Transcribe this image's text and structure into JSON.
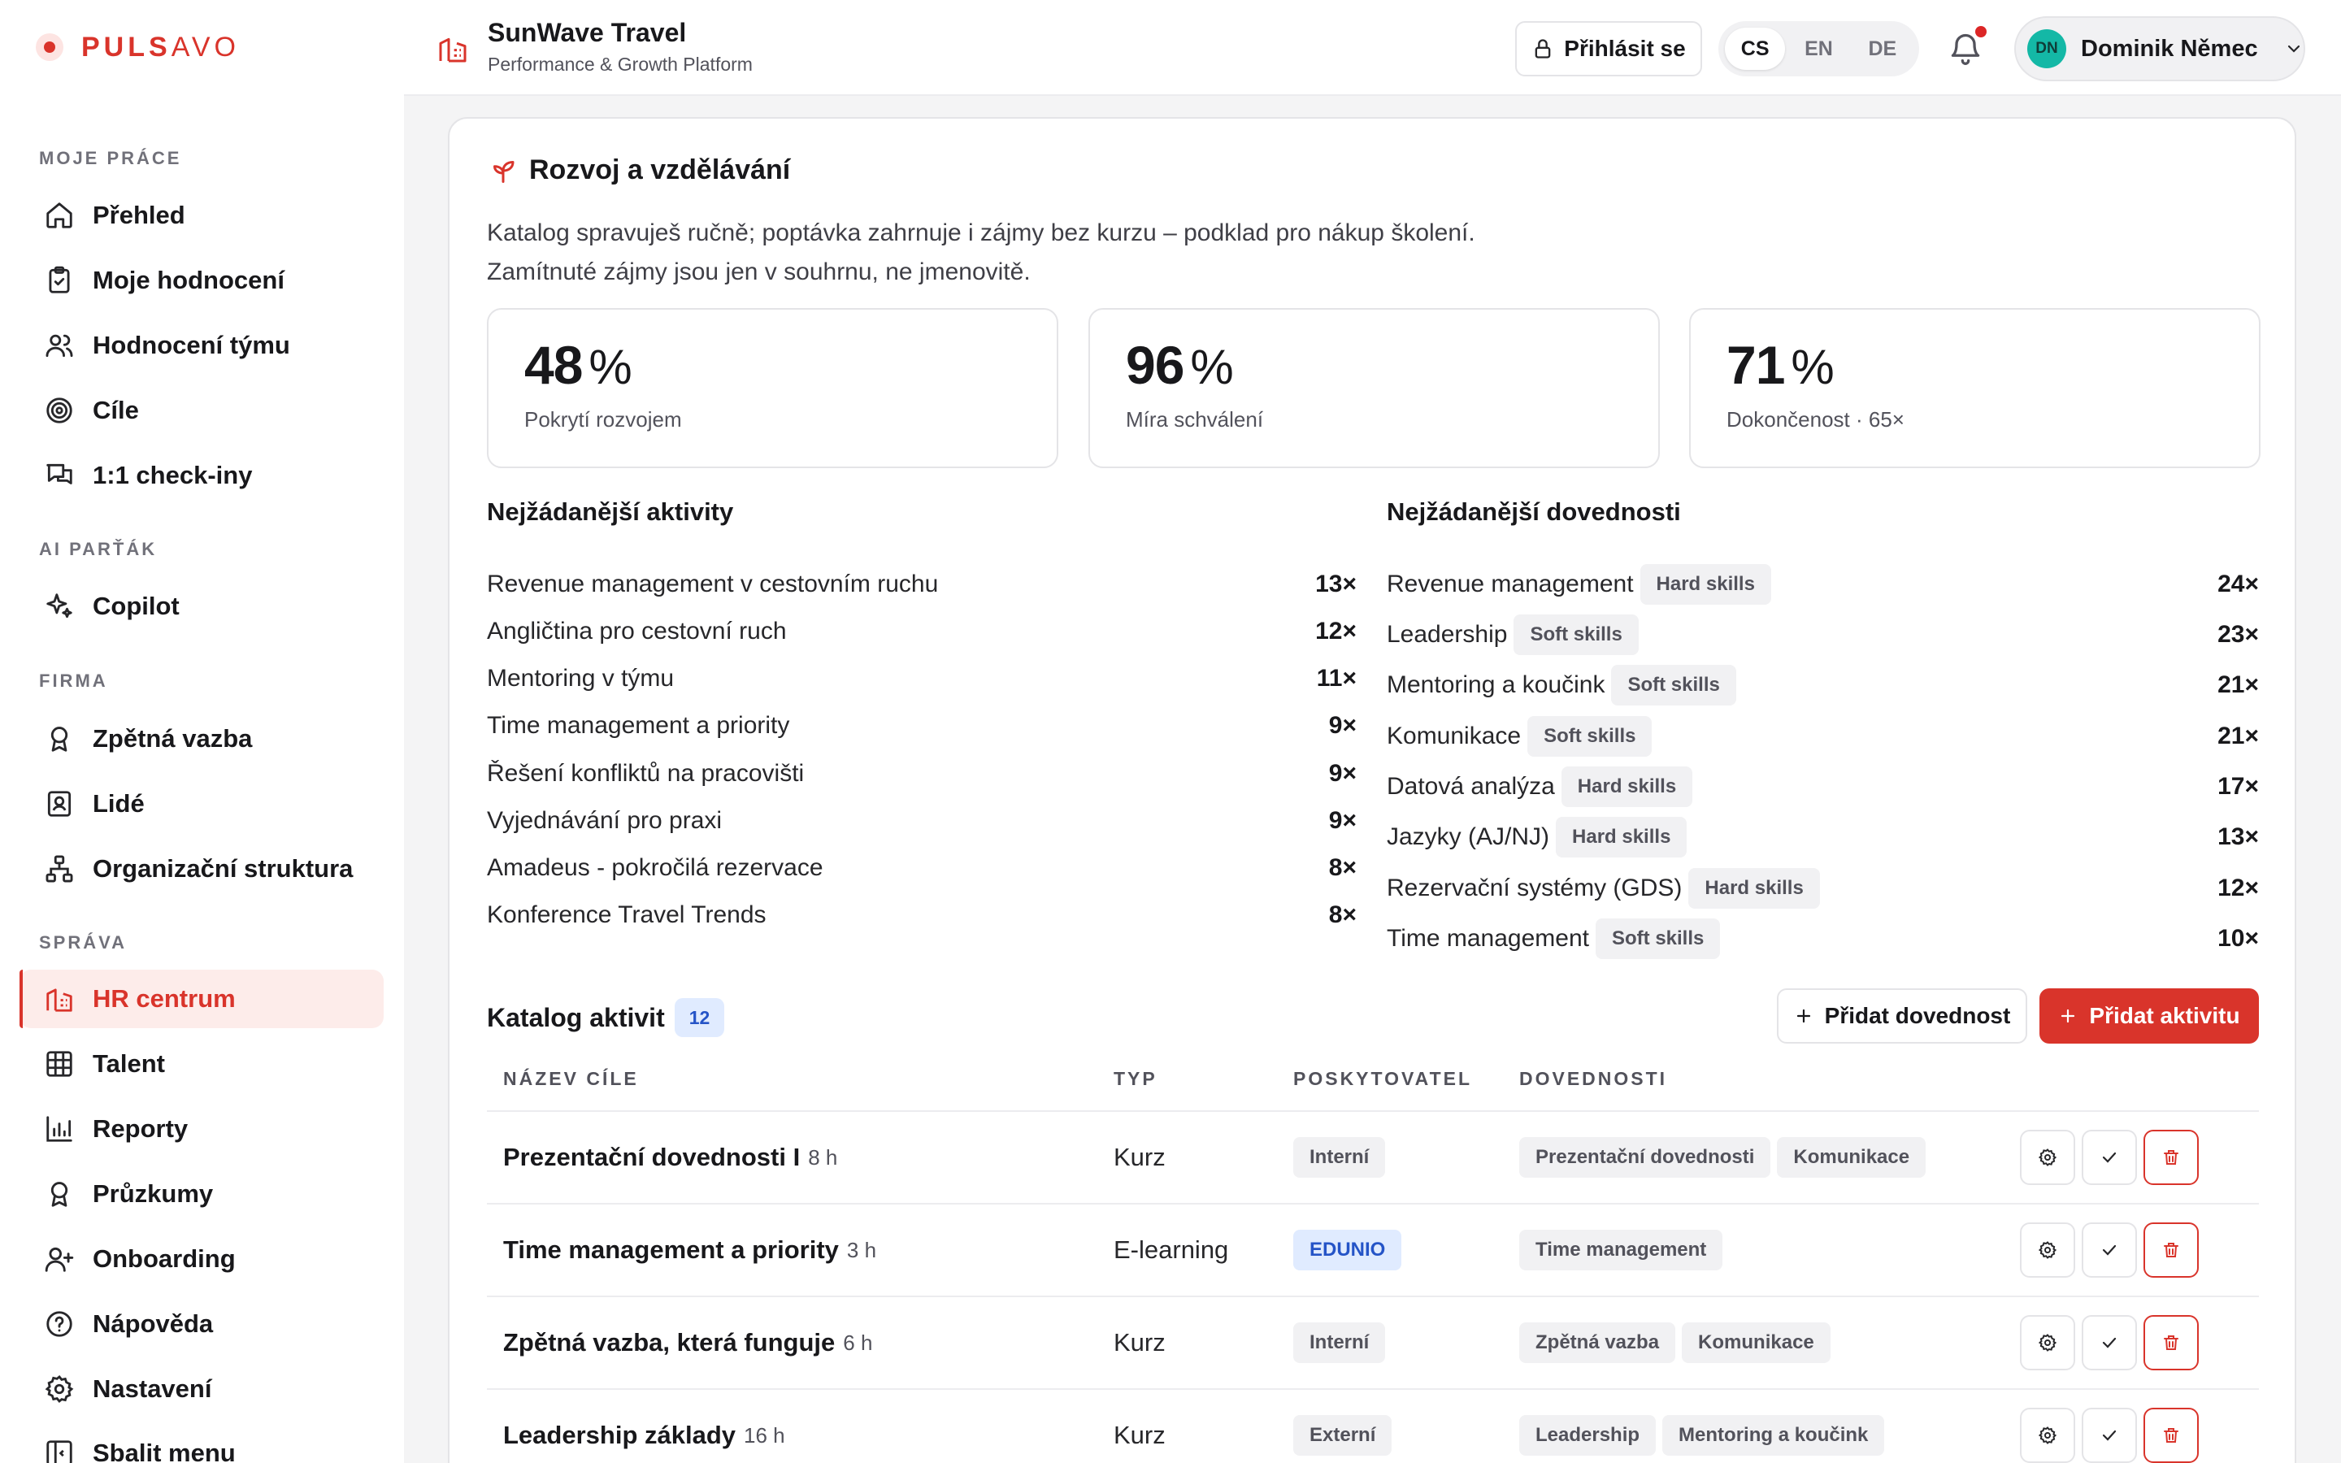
{
  "app": {
    "logo_bold": "PULS",
    "logo_rest": "AVO",
    "company_name": "SunWave Travel",
    "company_sub": "Performance & Growth Platform"
  },
  "colors": {
    "accent": "#d9342b",
    "accent_soft": "#fdecea",
    "info": "#2554c7",
    "info_soft": "#e0ebff",
    "avatar": "#14b8a6"
  },
  "header": {
    "login_label": "Přihlásit se",
    "languages": [
      "CS",
      "EN",
      "DE"
    ],
    "active_language": "CS",
    "user_initials": "DN",
    "user_name": "Dominik Němec"
  },
  "sidebar": {
    "sections": {
      "work": "MOJE PRÁCE",
      "ai": "AI PARŤÁK",
      "company": "FIRMA",
      "admin": "SPRÁVA"
    },
    "items": [
      {
        "label": "Přehled",
        "icon": "home-icon"
      },
      {
        "label": "Moje hodnocení",
        "icon": "clipboard-check-icon"
      },
      {
        "label": "Hodnocení týmu",
        "icon": "users-icon"
      },
      {
        "label": "Cíle",
        "icon": "target-icon"
      },
      {
        "label": "1:1 check-iny",
        "icon": "chat-icon"
      },
      {
        "label": "Copilot",
        "icon": "sparkles-icon"
      },
      {
        "label": "Zpětná vazba",
        "icon": "award-icon"
      },
      {
        "label": "Lidé",
        "icon": "contact-icon"
      },
      {
        "label": "Organizační struktura",
        "icon": "org-chart-icon"
      },
      {
        "label": "HR centrum",
        "icon": "building-icon",
        "active": true
      },
      {
        "label": "Talent",
        "icon": "grid-icon"
      },
      {
        "label": "Reporty",
        "icon": "bar-chart-icon"
      },
      {
        "label": "Průzkumy",
        "icon": "award-icon"
      },
      {
        "label": "Onboarding",
        "icon": "user-plus-icon"
      },
      {
        "label": "Nápověda",
        "icon": "help-icon"
      },
      {
        "label": "Nastavení",
        "icon": "gear-icon"
      },
      {
        "label": "Sbalit menu",
        "icon": "collapse-icon"
      }
    ]
  },
  "main": {
    "title": "Rozvoj a vzdělávání",
    "desc_line1": "Katalog spravuješ ručně; poptávka zahrnuje i zájmy bez kurzu – podklad pro nákup školení.",
    "desc_line2": "Zamítnuté zájmy jsou jen v souhrnu, ne jmenovitě.",
    "stats": [
      {
        "value": "48",
        "unit": "%",
        "label": "Pokrytí rozvojem"
      },
      {
        "value": "96",
        "unit": "%",
        "label": "Míra schválení"
      },
      {
        "value": "71",
        "unit": "%",
        "label": "Dokončenost · 65×"
      }
    ],
    "top_activities_title": "Nejžádanější aktivity",
    "top_activities": [
      {
        "name": "Revenue management v cestovním ruchu",
        "count": "13×"
      },
      {
        "name": "Angličtina pro cestovní ruch",
        "count": "12×"
      },
      {
        "name": "Mentoring v týmu",
        "count": "11×"
      },
      {
        "name": "Time management a priority",
        "count": "9×"
      },
      {
        "name": "Řešení konfliktů na pracovišti",
        "count": "9×"
      },
      {
        "name": "Vyjednávání pro praxi",
        "count": "9×"
      },
      {
        "name": "Amadeus - pokročilá rezervace",
        "count": "8×"
      },
      {
        "name": "Konference Travel Trends",
        "count": "8×"
      }
    ],
    "top_skills_title": "Nejžádanější dovednosti",
    "top_skills": [
      {
        "name": "Revenue management",
        "tag": "Hard skills",
        "count": "24×"
      },
      {
        "name": "Leadership",
        "tag": "Soft skills",
        "count": "23×"
      },
      {
        "name": "Mentoring a koučink",
        "tag": "Soft skills",
        "count": "21×"
      },
      {
        "name": "Komunikace",
        "tag": "Soft skills",
        "count": "21×"
      },
      {
        "name": "Datová analýza",
        "tag": "Hard skills",
        "count": "17×"
      },
      {
        "name": "Jazyky (AJ/NJ)",
        "tag": "Hard skills",
        "count": "13×"
      },
      {
        "name": "Rezervační systémy (GDS)",
        "tag": "Hard skills",
        "count": "12×"
      },
      {
        "name": "Time management",
        "tag": "Soft skills",
        "count": "10×"
      }
    ],
    "catalog": {
      "title": "Katalog aktivit",
      "count": "12",
      "add_skill_label": "Přidat dovednost",
      "add_activity_label": "Přidat aktivitu",
      "columns": [
        "NÁZEV CÍLE",
        "TYP",
        "POSKYTOVATEL",
        "DOVEDNOSTI"
      ],
      "rows": [
        {
          "name": "Prezentační dovednosti I",
          "hours": "8 h",
          "type": "Kurz",
          "provider": "Interní",
          "skills": [
            "Prezentační dovednosti",
            "Komunikace"
          ]
        },
        {
          "name": "Time management a priority",
          "hours": "3 h",
          "type": "E-learning",
          "provider": "EDUNIO",
          "provider_highlight": true,
          "skills": [
            "Time management"
          ]
        },
        {
          "name": "Zpětná vazba, která funguje",
          "hours": "6 h",
          "type": "Kurz",
          "provider": "Interní",
          "skills": [
            "Zpětná vazba",
            "Komunikace"
          ]
        },
        {
          "name": "Leadership základy",
          "hours": "16 h",
          "type": "Kurz",
          "provider": "Externí",
          "skills": [
            "Leadership",
            "Mentoring a koučink"
          ]
        }
      ]
    }
  }
}
